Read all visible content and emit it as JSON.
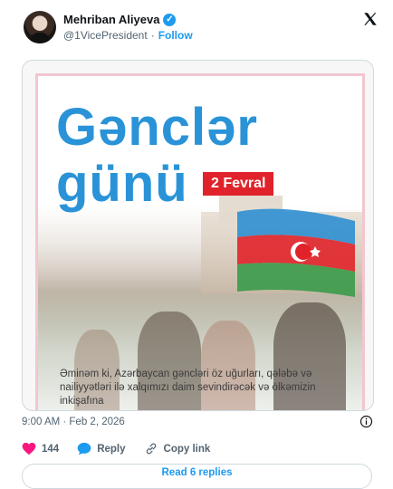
{
  "author": {
    "name": "Mehriban Aliyeva",
    "handle": "@1VicePresident",
    "separator": "·",
    "follow_label": "Follow"
  },
  "icons": {
    "verified": "verified-badge-icon",
    "x_logo": "x-logo-icon",
    "heart": "heart-icon",
    "reply": "reply-bubble-icon",
    "link": "link-icon",
    "info": "info-icon"
  },
  "poster": {
    "title_line1": "Gənclər",
    "title_line2": "günü",
    "date_badge": "2 Fevral",
    "caption": "Əminəm ki, Azərbaycan gəncləri öz uğurları, qələbə və nailiyyətləri ilə xalqımızı daim sevindirəcək və ölkəmizin inkişafına"
  },
  "post": {
    "timestamp": "9:00 AM · Feb 2, 2026"
  },
  "actions": {
    "like_count": "144",
    "reply_label": "Reply",
    "copy_link_label": "Copy link"
  },
  "replies": {
    "label": "Read 6 replies"
  },
  "colors": {
    "accent": "#1d9bf0",
    "heart": "#f91880",
    "title_blue": "#2a93d8",
    "badge_red": "#e0232a"
  }
}
